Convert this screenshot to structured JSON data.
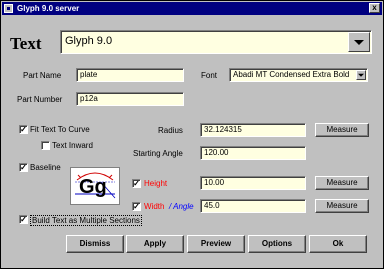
{
  "window": {
    "title": "Glyph 9.0 server",
    "close_glyph": "x"
  },
  "text_section": {
    "label": "Text",
    "value": "Glyph 9.0"
  },
  "part_name": {
    "label": "Part Name",
    "value": "plate"
  },
  "part_number": {
    "label": "Part Number",
    "value": "p12a"
  },
  "font": {
    "label": "Font",
    "value": "Abadi MT Condensed Extra Bold"
  },
  "fit_text_to_curve": {
    "label": "Fit Text To Curve",
    "checked": true
  },
  "text_inward": {
    "label": "Text Inward",
    "checked": false
  },
  "baseline": {
    "label": "Baseline",
    "checked": true
  },
  "build_multiple": {
    "label": "Build Text as Multiple Sections",
    "checked": true
  },
  "radius": {
    "label": "Radius",
    "value": "32.124315",
    "button": "Measure"
  },
  "starting_angle": {
    "label": "Starting Angle",
    "value": "120.00"
  },
  "height": {
    "label": "Height",
    "value": "10.00",
    "checked": true,
    "button": "Measure",
    "color": "#ff0000"
  },
  "width": {
    "label": "Width",
    "angle_label": "/ Angle",
    "value": "45.0",
    "checked": true,
    "button": "Measure",
    "color": "#ff0000",
    "angle_color": "#0000ff"
  },
  "preview_image": {
    "glyph_text": "Gg",
    "icon": "glyph-diagram-icon"
  },
  "buttons": {
    "dismiss": "Dismiss",
    "apply": "Apply",
    "preview": "Preview",
    "options": "Options",
    "ok": "Ok"
  },
  "check_mark": "✓"
}
